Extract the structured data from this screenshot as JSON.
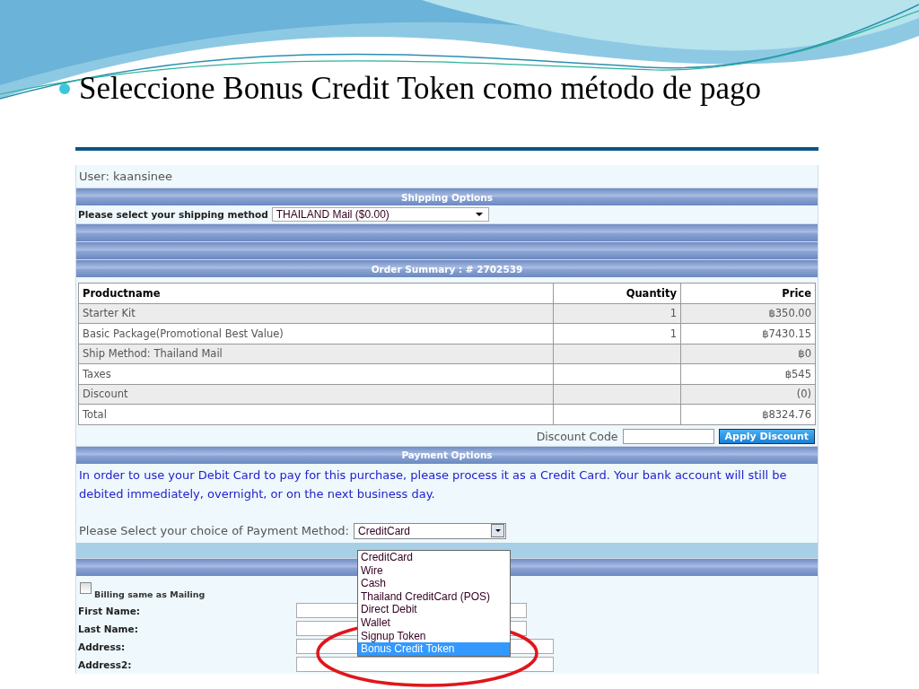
{
  "slide": {
    "bullet": "Seleccione Bonus Credit Token como método de pago"
  },
  "screen": {
    "user": "User: kaansinee",
    "shipping_header": "Shipping Options",
    "shipping_label": "Please select your shipping method",
    "shipping_select": "THAILAND Mail ($0.00)",
    "order_header": "Order Summary : # 2702539",
    "table": {
      "columns": [
        "Productname",
        "Quantity",
        "Price"
      ],
      "rows": [
        [
          "Starter Kit",
          "1",
          "฿350.00"
        ],
        [
          "Basic Package(Promotional Best Value)",
          "1",
          "฿7430.15"
        ],
        [
          "Ship Method: Thailand Mail",
          "",
          "฿0"
        ],
        [
          "Taxes",
          "",
          "฿545"
        ],
        [
          "Discount",
          "",
          "(0)"
        ],
        [
          "Total",
          "",
          "฿8324.76"
        ]
      ]
    },
    "discount": {
      "label": "Discount Code",
      "button": "Apply Discount"
    },
    "payment_header": "Payment Options",
    "notice": "In order to use your Debit Card to pay for this purchase, please process it as a Credit Card. Your bank account will still be debited immediately, overnight, or on the next business day.",
    "payment_label": "Please Select your choice of Payment Method:",
    "payment_select": "CreditCard",
    "payment_options": [
      {
        "label": "CreditCard",
        "selected": false
      },
      {
        "label": "Wire",
        "selected": false
      },
      {
        "label": "Cash",
        "selected": false
      },
      {
        "label": "Thailand CreditCard (POS)",
        "selected": false
      },
      {
        "label": "Direct Debit",
        "selected": false
      },
      {
        "label": "Wallet",
        "selected": false
      },
      {
        "label": "Signup Token",
        "selected": false
      },
      {
        "label": "Bonus Credit Token",
        "selected": true
      }
    ],
    "billing": {
      "label": "Billing same as Mailing",
      "checked": false
    },
    "fields": [
      {
        "label": "First Name:"
      },
      {
        "label": "Last Name:"
      },
      {
        "label": "Address:"
      },
      {
        "label": "Address2:"
      }
    ]
  }
}
